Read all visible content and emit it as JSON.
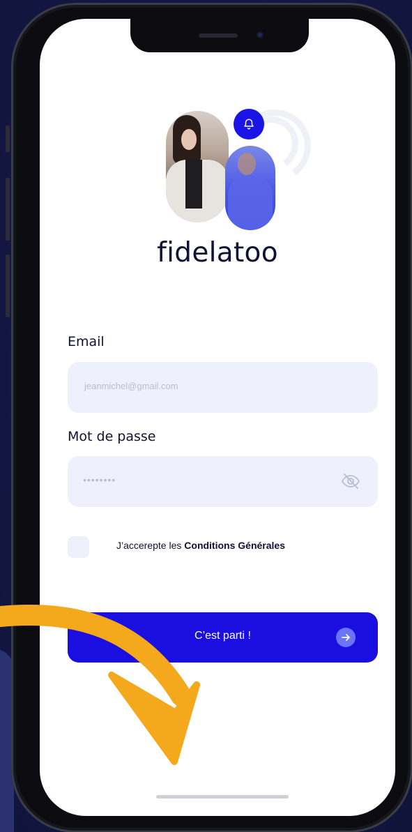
{
  "app": {
    "brand_name": "fidelatoo",
    "accent_color": "#1a0ee0"
  },
  "logo": {
    "icons": [
      "bell-icon"
    ]
  },
  "form": {
    "email_label": "Email",
    "email_placeholder": "jeanmichel@gmail.com",
    "password_label": "Mot de passe",
    "password_mask": "••••••••",
    "password_toggle_icon": "eye-slash-icon",
    "terms_prefix": "J’accerepte les ",
    "terms_link": "Conditions Générales",
    "terms_checked": false,
    "submit_label": "C’est parti !",
    "submit_icon": "arrow-right-icon"
  },
  "decoration": {
    "arrow_color": "#f4a81c"
  }
}
